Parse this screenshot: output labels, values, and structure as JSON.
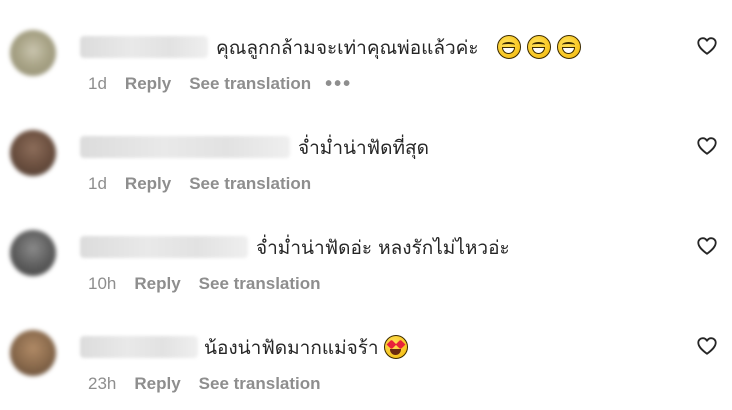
{
  "comments": [
    {
      "text": "คุณลูกกล้ามจะเท่าคุณพ่อแล้วค่ะ",
      "emojis": [
        "grinning-sweat-emoji",
        "grinning-sweat-emoji",
        "grinning-sweat-emoji"
      ],
      "time": "1d",
      "reply": "Reply",
      "translate": "See translation",
      "more": "•••"
    },
    {
      "text": "จ่ำม่ำน่าฟัดที่สุด",
      "emojis": [],
      "time": "1d",
      "reply": "Reply",
      "translate": "See translation"
    },
    {
      "text": "จ่ำม่ำน่าฟัดอ่ะ หลงรักไม่ไหวอ่ะ",
      "emojis": [],
      "time": "10h",
      "reply": "Reply",
      "translate": "See translation"
    },
    {
      "text": "น้องน่าฟัดมากแม่จร้า",
      "emojis": [
        "heart-eyes-emoji"
      ],
      "time": "23h",
      "reply": "Reply",
      "translate": "See translation"
    }
  ],
  "icons": {
    "like": "heart-outline-icon",
    "more": "more-options-icon"
  },
  "colors": {
    "text": "#262626",
    "meta": "#8e8e8e",
    "background": "#ffffff"
  }
}
